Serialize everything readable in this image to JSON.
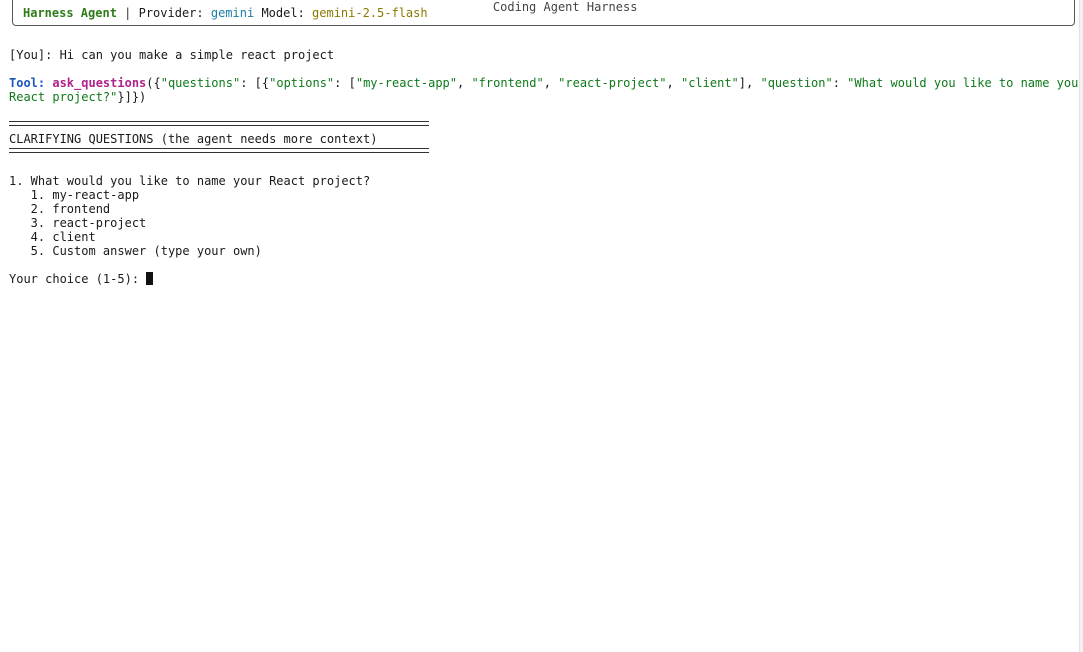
{
  "header": {
    "window_title": "Coding Agent Harness",
    "agent_name": "Harness Agent",
    "separator": " | ",
    "provider_label": "Provider: ",
    "provider_value": "gemini",
    "model_label": " Model: ",
    "model_value": "gemini-2.5-flash"
  },
  "user_message": "[You]: Hi can you make a simple react project",
  "tool_call": {
    "label": "Tool: ",
    "name": "ask_questions",
    "open": "({",
    "k_questions": "\"questions\"",
    "colon1": ": [{",
    "k_options": "\"options\"",
    "colon2": ": [",
    "opt1": "\"my-react-app\"",
    "comma1": ", ",
    "opt2": "\"frontend\"",
    "comma2": ", ",
    "opt3": "\"react-project\"",
    "comma3": ", ",
    "opt4": "\"client\"",
    "close_arr": "], ",
    "k_question": "\"question\"",
    "colon3": ": ",
    "question_part1": "\"What would you like to name your",
    "question_part2": "React project?\"",
    "close_all": "}]})"
  },
  "clarify": {
    "rule": "============================================================",
    "heading": "CLARIFYING QUESTIONS (the agent needs more context)"
  },
  "question": {
    "text": "1. What would you like to name your React project?",
    "options": [
      "   1. my-react-app",
      "   2. frontend",
      "   3. react-project",
      "   4. client",
      "   5. Custom answer (type your own)"
    ]
  },
  "prompt": "Your choice (1-5): "
}
